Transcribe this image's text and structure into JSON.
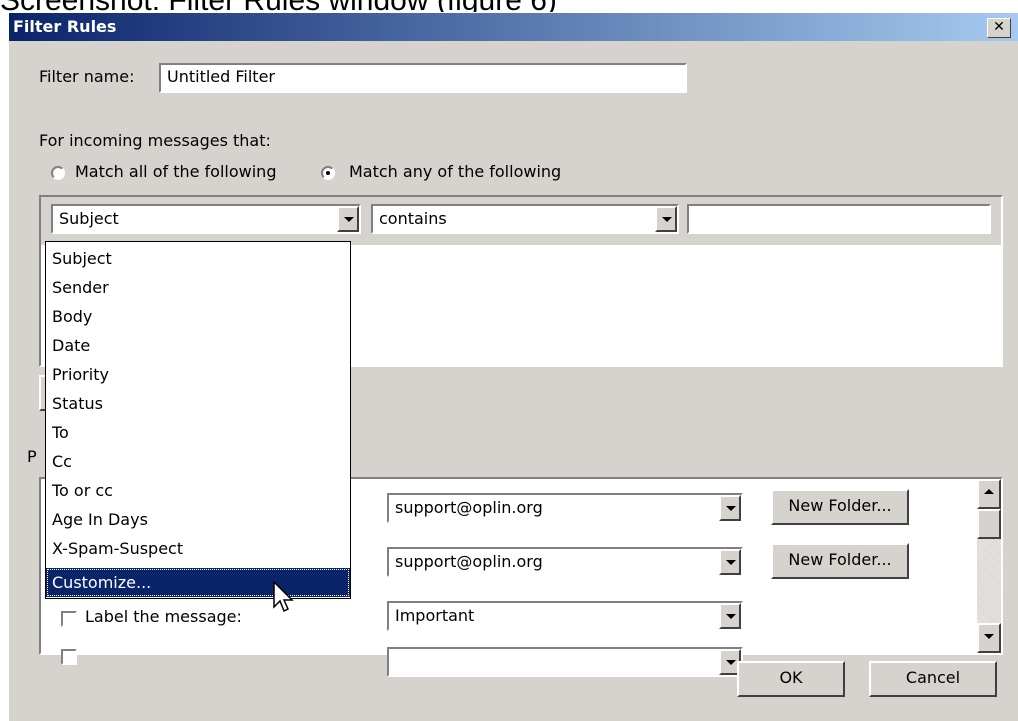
{
  "page_caption": "Screenshot: Filter Rules window (figure 6)",
  "window": {
    "title": "Filter Rules",
    "close_glyph": "✕"
  },
  "filter_name": {
    "label": "Filter name:",
    "value": "Untitled Filter"
  },
  "incoming": {
    "label": "For incoming messages that:",
    "radios": [
      {
        "label": "Match all of the following",
        "checked": false
      },
      {
        "label": "Match any of the following",
        "checked": true
      }
    ]
  },
  "condition_row": {
    "field_value": "Subject",
    "operator_value": "contains",
    "match_text": ""
  },
  "field_dropdown": {
    "options": [
      "Subject",
      "Sender",
      "Body",
      "Date",
      "Priority",
      "Status",
      "To",
      "Cc",
      "To or cc",
      "Age In Days",
      "X-Spam-Suspect"
    ],
    "selected_option": "Customize..."
  },
  "hidden_label_fragment": "P",
  "actions": [
    {
      "label": "",
      "value": "support@oplin.org",
      "button": "New Folder...",
      "checked": false
    },
    {
      "label": "",
      "value": "support@oplin.org",
      "button": "New Folder...",
      "checked": false
    },
    {
      "label": "Label the message:",
      "value": "Important",
      "button": "",
      "checked": false
    },
    {
      "label": "",
      "value": "",
      "button": "",
      "checked": false
    }
  ],
  "buttons": {
    "ok": "OK",
    "cancel": "Cancel"
  },
  "colors": {
    "dialog_bg": "#d6d3ce",
    "title_bar": "#0a246a",
    "selection": "#0a246a"
  },
  "icons": {
    "cursor": "arrow-pointer-icon",
    "dropdown_arrow": "chevron-down-icon"
  }
}
